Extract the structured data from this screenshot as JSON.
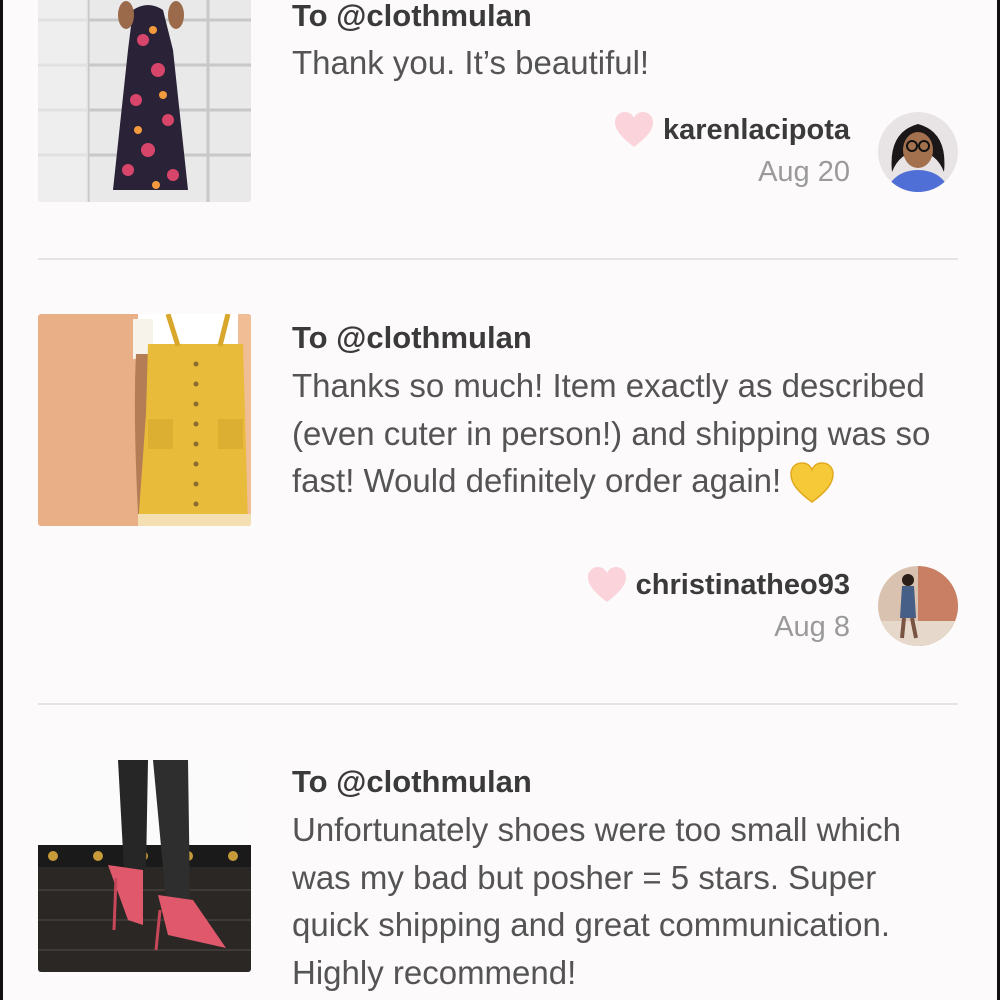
{
  "reviews": [
    {
      "recipient": "To @clothmulan",
      "message": "Thank you. It’s beautiful!",
      "username": "karenlacipota",
      "date": "Aug 20"
    },
    {
      "recipient": "To @clothmulan",
      "message": "Thanks so much! Item exactly as described (even cuter in person!) and shipping was so fast! Would definitely order again!",
      "username": "christinatheo93",
      "date": "Aug 8"
    },
    {
      "recipient": "To @clothmulan",
      "message": "Unfortunately shoes were too small which was my bad but posher = 5 stars. Super quick shipping and great communication. Highly recommend!"
    }
  ],
  "icons": {
    "like": "heart-icon",
    "emoji": "yellow-heart-emoji"
  },
  "colors": {
    "heart": "#fbd3da",
    "background": "#fcfafa",
    "divider": "#e6e3e3",
    "emoji": "#f6c938"
  }
}
